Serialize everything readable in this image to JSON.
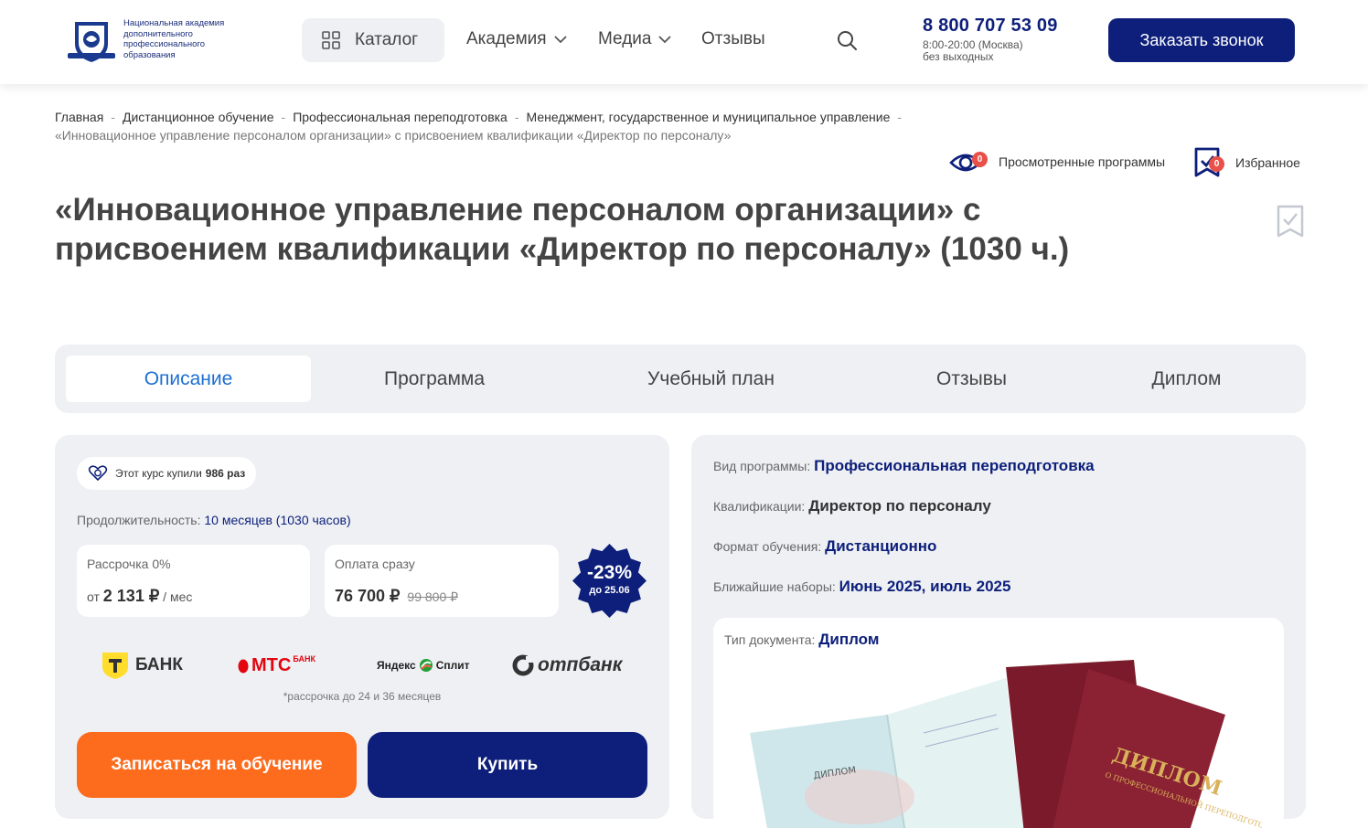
{
  "header": {
    "logo_text": "Национальная академия дополнительного профессионального образования",
    "catalog_label": "Каталог",
    "nav": [
      {
        "label": "Академия",
        "has_dropdown": true
      },
      {
        "label": "Медиа",
        "has_dropdown": true
      },
      {
        "label": "Отзывы",
        "has_dropdown": false
      }
    ],
    "phone": "8 800 707 53 09",
    "hours_line1": "8:00-20:00 (Москва)",
    "hours_line2": "без выходных",
    "call_button": "Заказать звонок"
  },
  "breadcrumb": {
    "items": [
      "Главная",
      "Дистанционное обучение",
      "Профессиональная переподготовка",
      "Менеджмент, государственное и муниципальное управление"
    ],
    "current": "«Инновационное управление персоналом организации» с присвоением квалификации «Директор по персоналу»"
  },
  "user_tools": {
    "viewed_label": "Просмотренные программы",
    "viewed_count": "0",
    "favorites_label": "Избранное",
    "favorites_count": "0"
  },
  "page_title": "«Инновационное управление персоналом организации» с присвоением квалификации «Директор по персоналу» (1030 ч.)",
  "tabs": [
    {
      "label": "Описание",
      "active": true
    },
    {
      "label": "Программа",
      "active": false
    },
    {
      "label": "Учебный план",
      "active": false
    },
    {
      "label": "Отзывы",
      "active": false
    },
    {
      "label": "Диплом",
      "active": false
    }
  ],
  "purchase": {
    "bought_prefix": "Этот курс купили",
    "bought_count": "986 раз",
    "duration_label": "Продолжительность:",
    "duration_value": "10 месяцев (1030 часов)",
    "installment_label": "Рассрочка 0%",
    "installment_prefix": "от",
    "installment_amount": "2 131 ₽",
    "installment_suffix": "/ мес",
    "pay_now_label": "Оплата сразу",
    "pay_now_amount": "76 700 ₽",
    "pay_now_old": "99 800 ₽",
    "discount_percent": "-23%",
    "discount_until": "до 25.06",
    "banks": [
      "БАНК",
      "МТС",
      "БАНК",
      "Яндекс",
      "Сплит",
      "отпбанк"
    ],
    "installment_note": "*рассрочка до 24 и 36 месяцев",
    "enroll_button": "Записаться на обучение",
    "buy_button": "Купить"
  },
  "program_info": {
    "type_label": "Вид программы:",
    "type_value": "Профессиональная переподготовка",
    "qual_label": "Квалификации:",
    "qual_value": "Директор по персоналу",
    "format_label": "Формат обучения:",
    "format_value": "Дистанционно",
    "intake_label": "Ближайшие наборы:",
    "intake_value": "Июнь 2025, июль 2025",
    "doc_label": "Тип документа:",
    "doc_value": "Диплом",
    "diploma_cover_text": "ДИПЛОМ",
    "diploma_cover_sub": "О ПРОФЕССИОНАЛЬНОЙ ПЕРЕПОДГОТОВКЕ"
  },
  "colors": {
    "brand_navy": "#0d1f7a",
    "accent_orange": "#fd6b1d",
    "active_tab": "#1d6fd3",
    "badge_red": "#e8504a"
  }
}
